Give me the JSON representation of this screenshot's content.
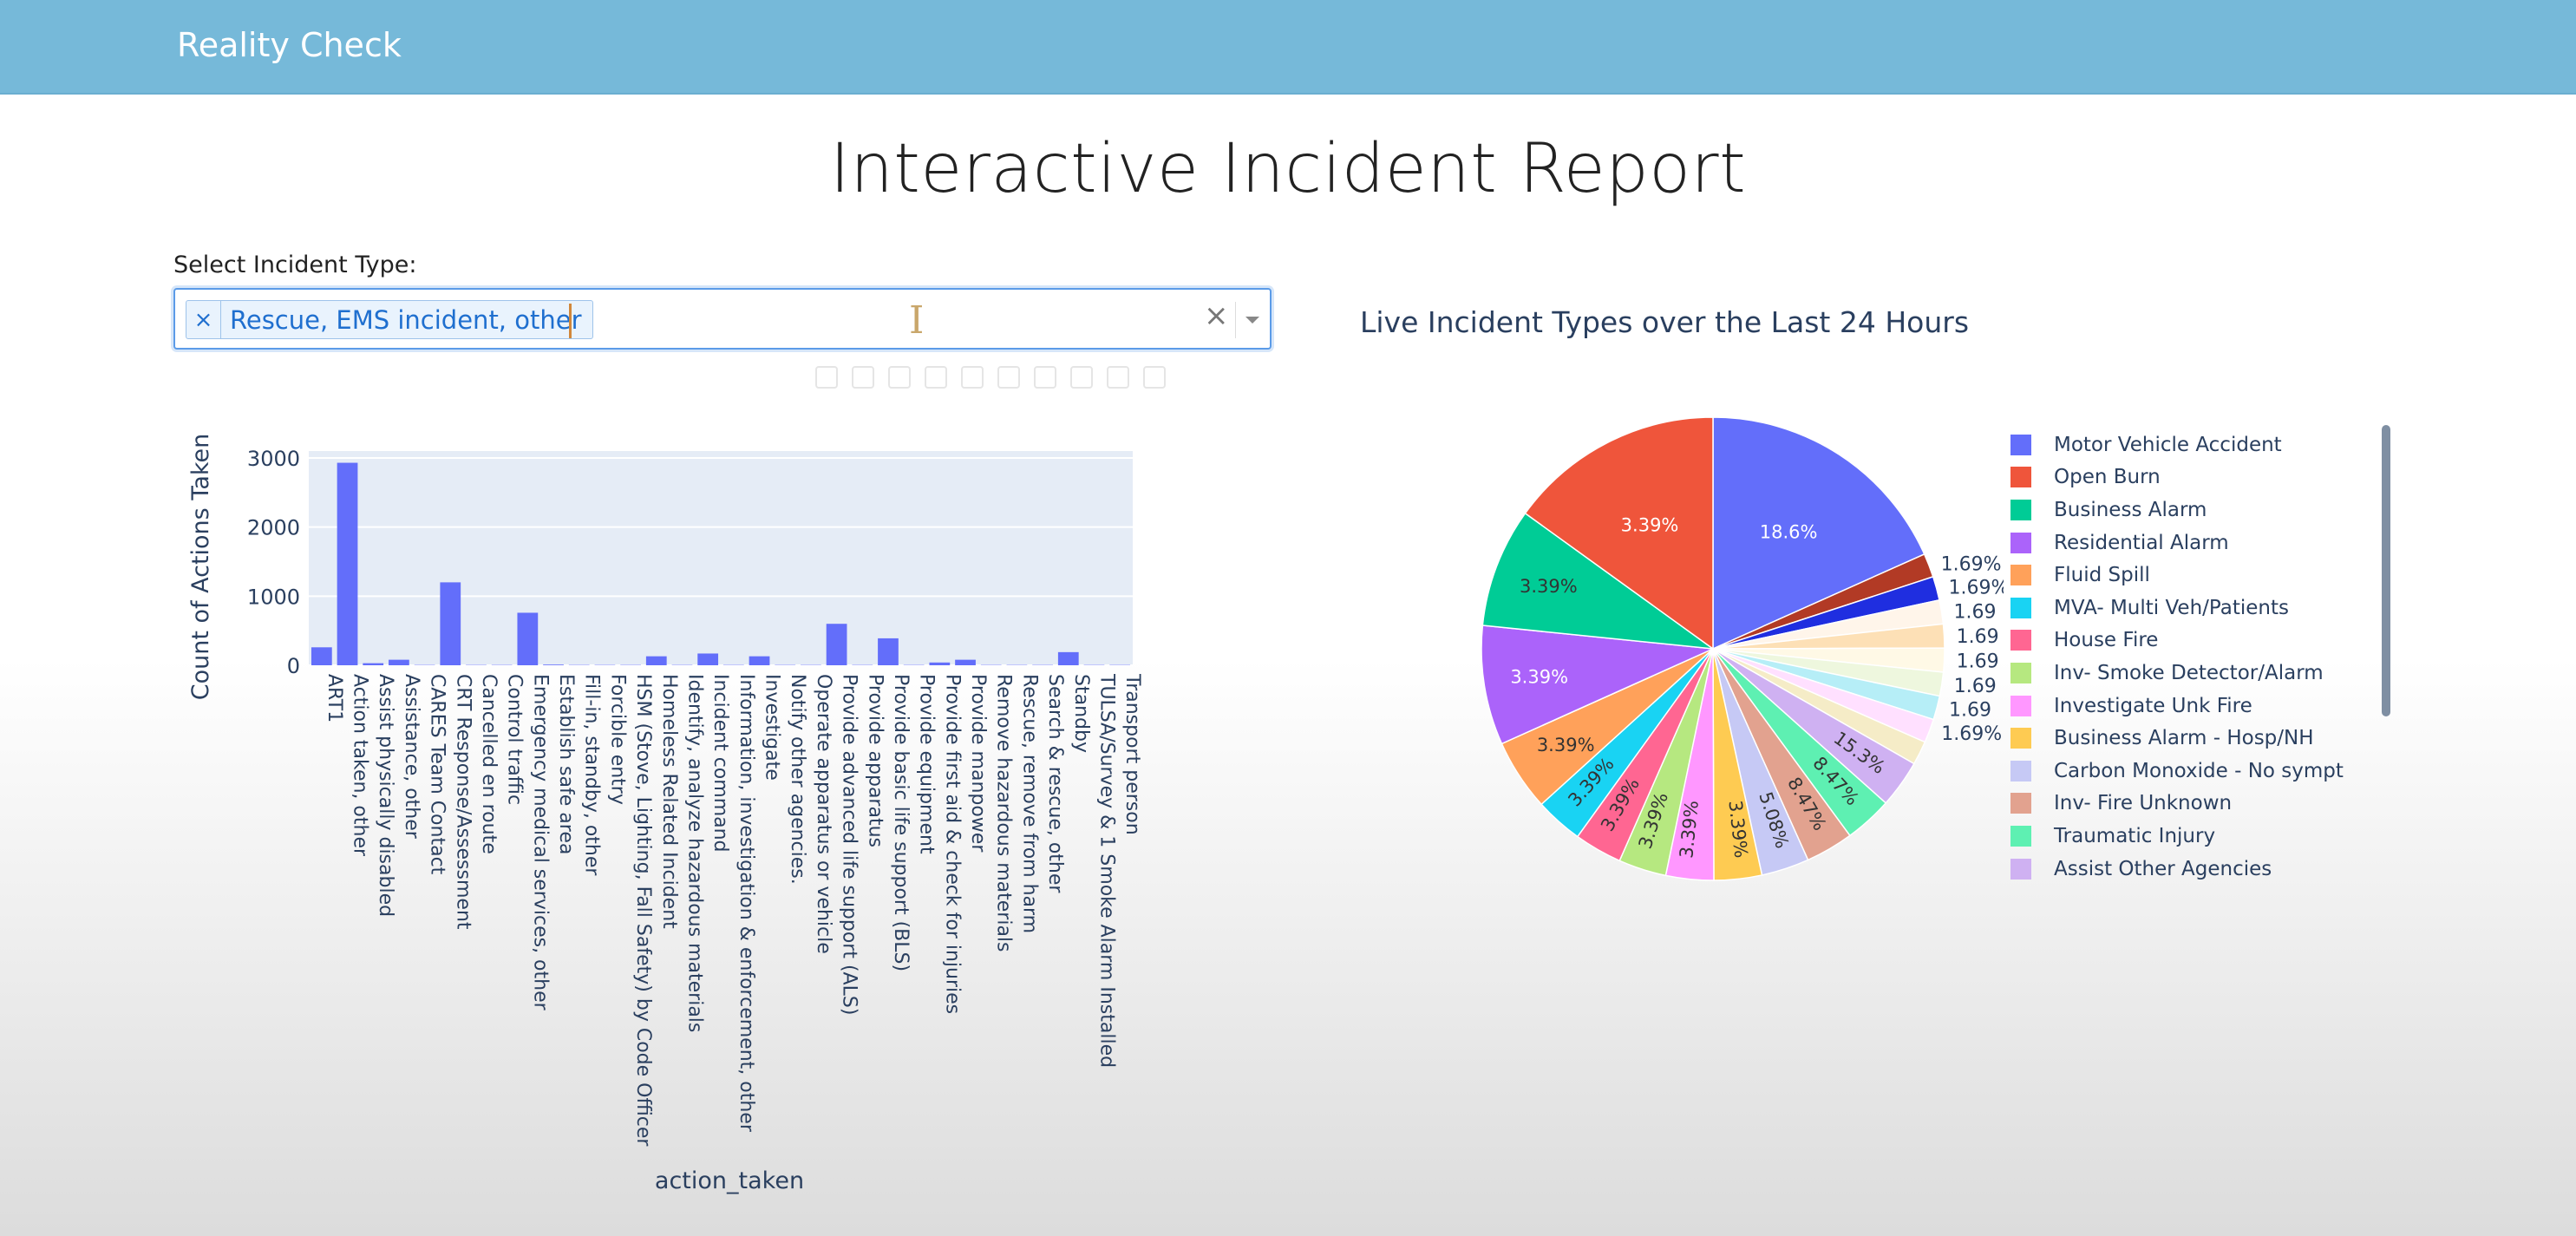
{
  "navbar": {
    "brand": "Reality Check"
  },
  "page": {
    "title": "Interactive Incident Report"
  },
  "filter": {
    "label": "Select Incident Type:",
    "selected": [
      "Rescue, EMS incident, other"
    ],
    "remove_glyph": "×",
    "clear_glyph": "×"
  },
  "icons": {
    "chip_remove": "close-icon",
    "clear": "clear-icon",
    "dropdown": "chevron-down-icon"
  },
  "colors": {
    "navbar": "#76b9d9",
    "bar": "#636efa",
    "plot_bg": "#e5ecf6",
    "chip_text": "#1f6fcf"
  },
  "chart_data": [
    {
      "type": "bar",
      "title": "",
      "xlabel": "action_taken",
      "ylabel": "Count of Actions Taken",
      "ylim": [
        0,
        3100
      ],
      "yticks": [
        0,
        1000,
        2000,
        3000
      ],
      "grid": true,
      "categories": [
        "ART1",
        "Action taken, other",
        "Assist physically disabled",
        "Assistance, other",
        "CARES Team Contact",
        "CRT Response/Assessment",
        "Cancelled en route",
        "Control traffic",
        "Emergency medical services, other",
        "Establish safe area",
        "Fill-in, standby, other",
        "Forcible entry",
        "HSM (Stove, Lighting, Fall Safety) by Code Officer",
        "Homeless Related Incident",
        "Identify, analyze hazardous materials",
        "Incident command",
        "Information, investigation & enforcement, other",
        "Investigate",
        "Notify other agencies.",
        "Operate apparatus or vehicle",
        "Provide advanced life support (ALS)",
        "Provide apparatus",
        "Provide basic life support (BLS)",
        "Provide equipment",
        "Provide first aid & check for injuries",
        "Provide manpower",
        "Remove hazardous materials",
        "Rescue, remove from harm",
        "Search & rescue, other",
        "Standby",
        "TULSA/Survey & 1 Smoke Alarm Installed",
        "Transport person"
      ],
      "values": [
        260,
        2930,
        30,
        80,
        5,
        1200,
        5,
        5,
        760,
        10,
        5,
        5,
        5,
        130,
        5,
        170,
        5,
        130,
        5,
        5,
        600,
        5,
        390,
        5,
        40,
        80,
        5,
        5,
        5,
        190,
        5,
        5
      ]
    },
    {
      "type": "pie",
      "title": "Live Incident Types over the Last 24 Hours",
      "legend_position": "right",
      "labels": [
        "Motor Vehicle Accident",
        "Open Burn",
        "Business Alarm",
        "Residential Alarm",
        "Fluid Spill",
        "MVA- Multi Veh/Patients",
        "House Fire",
        "Inv- Smoke Detector/Alarm",
        "Investigate Unk Fire",
        "Business Alarm - Hosp/NH",
        "Carbon Monoxide - No sympt",
        "Inv- Fire Unknown",
        "Traumatic Injury",
        "Assist Other Agencies"
      ],
      "colors": [
        "#636efa",
        "#ef553b",
        "#00cc96",
        "#ab63fa",
        "#ffa15a",
        "#19d3f3",
        "#ff6692",
        "#b6e880",
        "#ff97ff",
        "#fecb52",
        "#c6c9f5",
        "#e2a28f",
        "#5ef0b2",
        "#cfb1f2"
      ],
      "slices_clockwise_from_top": [
        {
          "label": "Motor Vehicle Accident",
          "value": 18.6,
          "color": "#636efa"
        },
        {
          "label": "",
          "value": 1.69,
          "color": "#b23a25"
        },
        {
          "label": "",
          "value": 1.69,
          "color": "#1f2ee0"
        },
        {
          "label": "",
          "value": 1.69,
          "color": "#fff5ea"
        },
        {
          "label": "",
          "value": 1.69,
          "color": "#fde0b6"
        },
        {
          "label": "",
          "value": 1.69,
          "color": "#fff9e6"
        },
        {
          "label": "",
          "value": 1.69,
          "color": "#eef7de"
        },
        {
          "label": "",
          "value": 1.69,
          "color": "#b6eef7"
        },
        {
          "label": "",
          "value": 1.69,
          "color": "#ffe0ff"
        },
        {
          "label": "",
          "value": 1.69,
          "color": "#f5ecc7"
        },
        {
          "label": "",
          "value": 3.39,
          "color": "#cfb1f2"
        },
        {
          "label": "",
          "value": 3.39,
          "color": "#5ef0b2"
        },
        {
          "label": "",
          "value": 3.39,
          "color": "#e2a28f"
        },
        {
          "label": "",
          "value": 3.39,
          "color": "#c6c9f5"
        },
        {
          "label": "",
          "value": 3.39,
          "color": "#fecb52"
        },
        {
          "label": "",
          "value": 3.39,
          "color": "#ff97ff"
        },
        {
          "label": "",
          "value": 3.39,
          "color": "#b6e880"
        },
        {
          "label": "",
          "value": 3.39,
          "color": "#ff6692"
        },
        {
          "label": "",
          "value": 3.39,
          "color": "#19d3f3"
        },
        {
          "label": "",
          "value": 5.08,
          "color": "#ffa15a"
        },
        {
          "label": "",
          "value": 8.47,
          "color": "#ab63fa"
        },
        {
          "label": "",
          "value": 8.47,
          "color": "#00cc96"
        },
        {
          "label": "",
          "value": 15.3,
          "color": "#ef553b"
        }
      ],
      "inside_labels": [
        "18.6%",
        "15.3%",
        "8.47%",
        "8.47%",
        "5.08%",
        "3.39%",
        "3.39%",
        "3.39%",
        "3.39%",
        "3.39%",
        "3.39%",
        "3.39%",
        "3.39%",
        "3.39%"
      ],
      "outside_labels": [
        "1.69%",
        "1.69%",
        "1.69",
        "1.69",
        "1.69",
        "1.69",
        "1.69",
        "1.69%"
      ]
    }
  ]
}
